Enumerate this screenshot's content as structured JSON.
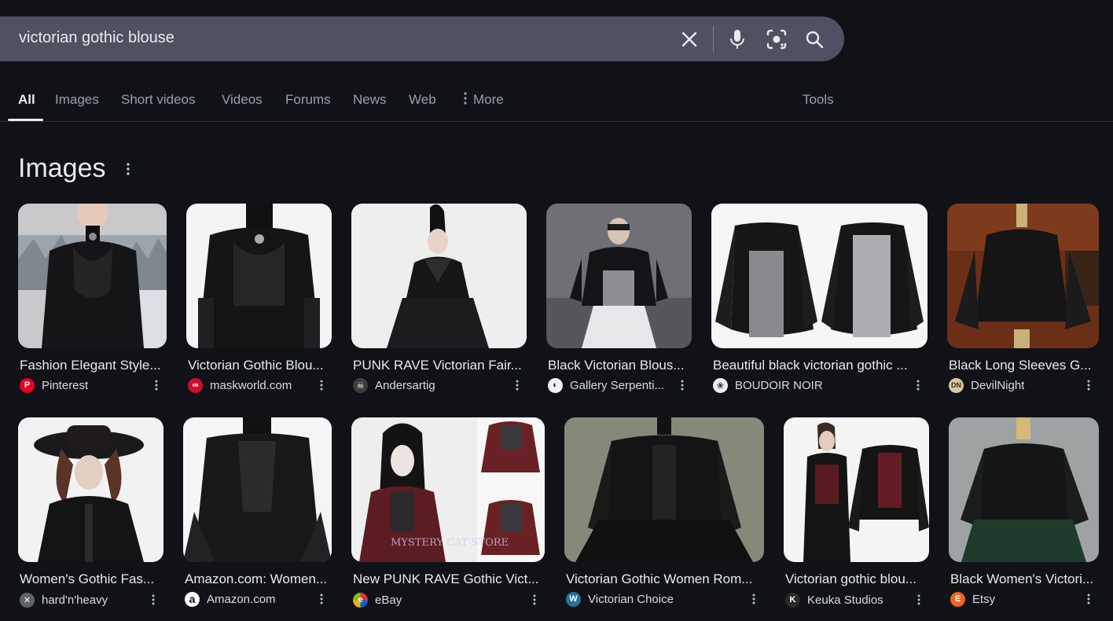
{
  "search": {
    "query": "victorian gothic blouse",
    "icons": [
      "close-icon",
      "microphone-icon",
      "lens-icon",
      "search-icon"
    ]
  },
  "tabs": [
    {
      "label": "All",
      "active": true
    },
    {
      "label": "Images"
    },
    {
      "label": "Short videos"
    },
    {
      "label": "Videos"
    },
    {
      "label": "Forums"
    },
    {
      "label": "News"
    },
    {
      "label": "Web"
    },
    {
      "label": "More"
    }
  ],
  "tools_label": "Tools",
  "images_section": {
    "title": "Images",
    "row1": [
      {
        "title": "Fashion Elegant Style...",
        "source": "Pinterest",
        "favicon_color": "#e60023",
        "favicon_glyph": "P"
      },
      {
        "title": "Victorian Gothic Blou...",
        "source": "maskworld.com",
        "favicon_color": "#c8102e",
        "favicon_glyph": "∞"
      },
      {
        "title": "PUNK RAVE Victorian Fair...",
        "source": "Andersartig",
        "favicon_color": "#3c3c3c",
        "favicon_glyph": "☠"
      },
      {
        "title": "Black Victorian Blous...",
        "source": "Gallery Serpenti...",
        "favicon_color": "#f1f1f1",
        "favicon_glyph": "◐"
      },
      {
        "title": "Beautiful black victorian gothic ...",
        "source": "BOUDOIR NOIR",
        "favicon_color": "#ececec",
        "favicon_glyph": "❀"
      },
      {
        "title": "Black Long Sleeves G...",
        "source": "DevilNight",
        "favicon_color": "#d9c8a4",
        "favicon_glyph": "DN"
      }
    ],
    "row2": [
      {
        "title": "Women's Gothic Fas...",
        "source": "hard'n'heavy",
        "favicon_color": "#5f6368",
        "favicon_glyph": "✕"
      },
      {
        "title": "Amazon.com: Women...",
        "source": "Amazon.com",
        "favicon_color": "#ffffff",
        "favicon_glyph": "a"
      },
      {
        "title": "New PUNK RAVE Gothic Vict...",
        "source": "eBay",
        "favicon_color": "#ffffff",
        "favicon_glyph": "e"
      },
      {
        "title": "Victorian Gothic Women Rom...",
        "source": "Victorian Choice",
        "favicon_color": "#21759b",
        "favicon_glyph": "W"
      },
      {
        "title": "Victorian gothic blou...",
        "source": "Keuka Studios",
        "favicon_color": "#2b2b2b",
        "favicon_glyph": "K"
      },
      {
        "title": "Black Women's Victori...",
        "source": "Etsy",
        "favicon_color": "#f1641e",
        "favicon_glyph": "E"
      }
    ],
    "watermark_text": "MYSTERY CAT STORE"
  },
  "colors": {
    "background": "#101218",
    "searchbar": "#4d5161",
    "text_primary": "#e8eaed",
    "text_secondary": "#9aa0a6"
  }
}
